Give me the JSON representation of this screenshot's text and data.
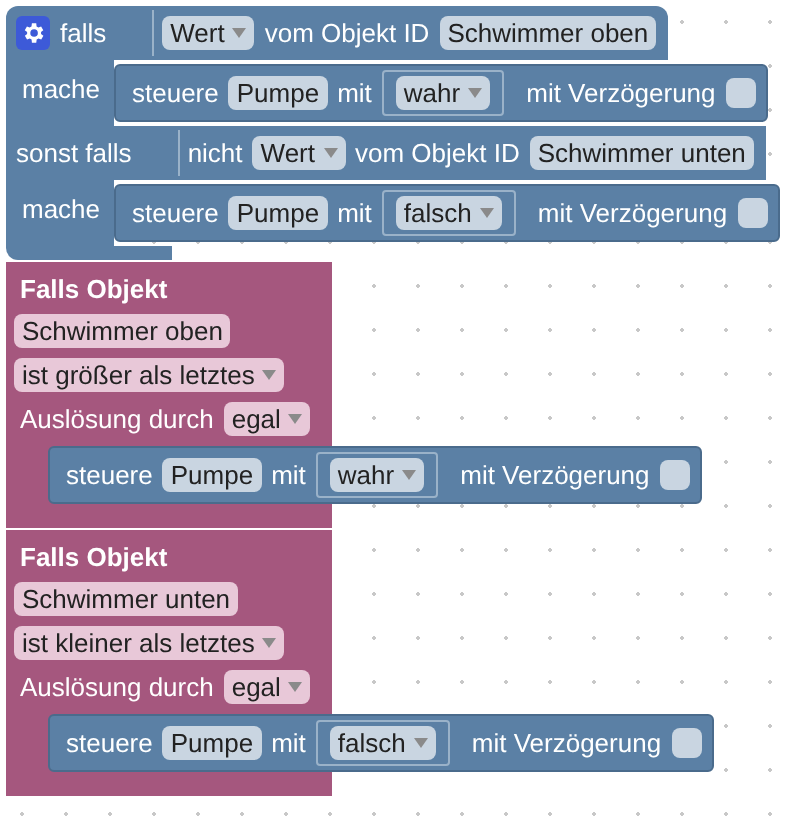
{
  "if_block": {
    "branches": [
      {
        "keyword": "falls",
        "condition": {
          "property": "Wert",
          "of_label": "vom Objekt ID",
          "object": "Schwimmer oben"
        },
        "do_label": "mache",
        "action": {
          "verb": "steuere",
          "target": "Pumpe",
          "with_label": "mit",
          "value": "wahr",
          "delay_label": "mit Verzögerung",
          "delay": false
        }
      },
      {
        "keyword": "sonst falls",
        "condition": {
          "negation": "nicht",
          "property": "Wert",
          "of_label": "vom Objekt ID",
          "object": "Schwimmer unten"
        },
        "do_label": "mache",
        "action": {
          "verb": "steuere",
          "target": "Pumpe",
          "with_label": "mit",
          "value": "falsch",
          "delay_label": "mit Verzögerung",
          "delay": false
        }
      }
    ]
  },
  "triggers": [
    {
      "title": "Falls Objekt",
      "object": "Schwimmer oben",
      "comparison": "ist größer als letztes",
      "trigger_label": "Auslösung durch",
      "trigger_value": "egal",
      "action": {
        "verb": "steuere",
        "target": "Pumpe",
        "with_label": "mit",
        "value": "wahr",
        "delay_label": "mit Verzögerung",
        "delay": false
      }
    },
    {
      "title": "Falls Objekt",
      "object": "Schwimmer unten",
      "comparison": "ist kleiner als letztes",
      "trigger_label": "Auslösung durch",
      "trigger_value": "egal",
      "action": {
        "verb": "steuere",
        "target": "Pumpe",
        "with_label": "mit",
        "value": "falsch",
        "delay_label": "mit Verzögerung",
        "delay": false
      }
    }
  ]
}
